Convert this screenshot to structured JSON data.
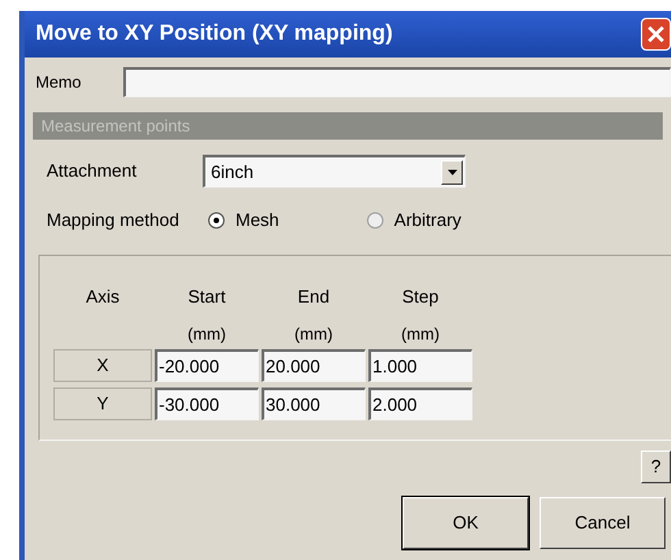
{
  "window": {
    "title": "Move to XY Position (XY mapping)"
  },
  "memo": {
    "label": "Memo"
  },
  "section": {
    "title": "Measurement points"
  },
  "attachment": {
    "label": "Attachment",
    "value": "6inch"
  },
  "mapping_method": {
    "label": "Mapping method",
    "options": [
      {
        "label": "Mesh",
        "selected": true
      },
      {
        "label": "Arbitrary",
        "selected": false
      }
    ]
  },
  "table": {
    "columns": [
      {
        "title": "Axis"
      },
      {
        "title": "Start",
        "unit": "(mm)"
      },
      {
        "title": "End",
        "unit": "(mm)"
      },
      {
        "title": "Step",
        "unit": "(mm)"
      }
    ],
    "rows": [
      {
        "axis": "X",
        "start": "-20.000",
        "end": "20.000",
        "step": "1.000"
      },
      {
        "axis": "Y",
        "start": "-30.000",
        "end": "30.000",
        "step": "2.000"
      }
    ]
  },
  "help_button": "?",
  "buttons": [
    "OK",
    "Cancel"
  ]
}
